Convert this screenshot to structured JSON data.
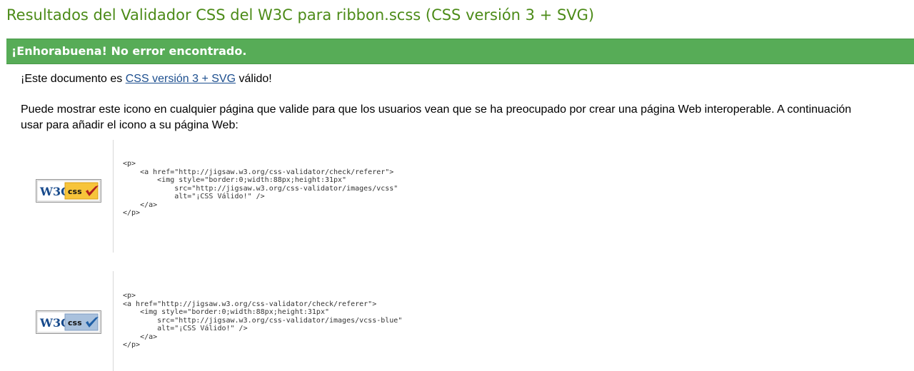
{
  "page": {
    "title": "Resultados del Validador CSS del W3C para ribbon.scss (CSS versión 3 + SVG)"
  },
  "banner": {
    "text": "¡Enhorabuena! No error encontrado."
  },
  "valid_message": {
    "prefix": "¡Este documento es ",
    "link_text": "CSS versión 3 + SVG",
    "suffix": " válido!"
  },
  "info": {
    "line1": "Puede mostrar este icono en cualquier página que valide para que los usuarios vean que se ha preocupado por crear una página Web interoperable. A continuación",
    "line2": "usar para añadir el icono a su página Web:"
  },
  "badges": [
    {
      "logo_text": "W3C",
      "label": "css",
      "variant": "gold",
      "colors": {
        "panel": "#f7c43a",
        "check": "#b01e1e"
      },
      "code": "<p>\n    <a href=\"http://jigsaw.w3.org/css-validator/check/referer\">\n        <img style=\"border:0;width:88px;height:31px\"\n            src=\"http://jigsaw.w3.org/css-validator/images/vcss\"\n            alt=\"¡CSS Válido!\" />\n    </a>\n</p>"
    },
    {
      "logo_text": "W3C",
      "label": "css",
      "variant": "blue",
      "colors": {
        "panel": "#a9c1dd",
        "check": "#1f5fa6"
      },
      "code": "<p>\n<a href=\"http://jigsaw.w3.org/css-validator/check/referer\">\n    <img style=\"border:0;width:88px;height:31px\"\n        src=\"http://jigsaw.w3.org/css-validator/images/vcss-blue\"\n        alt=\"¡CSS Válido!\" />\n    </a>\n</p>"
    }
  ],
  "colors": {
    "title": "#4c8b18",
    "banner": "#57ac57",
    "link": "#1d4f8f"
  }
}
